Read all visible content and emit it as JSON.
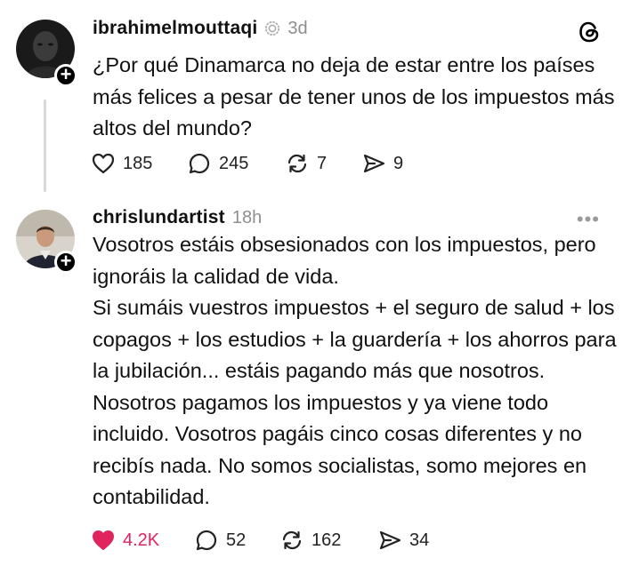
{
  "posts": [
    {
      "username": "ibrahimelmouttaqi",
      "time": "3d",
      "text": "¿Por qué Dinamarca no deja de estar entre los países más felices a pesar de tener unos de los impuestos más altos del mundo?",
      "stats": {
        "likes": "185",
        "replies": "245",
        "reposts": "7",
        "shares": "9"
      }
    },
    {
      "username": "chrislundartist",
      "time": "18h",
      "text": "Vosotros estáis obsesionados con los impuestos, pero ignoráis la calidad de vida.\nSi sumáis vuestros impuestos +  el seguro de salud +  los copagos + los estudios + la guardería + los ahorros para la jubilación... estáis pagando más que nosotros. Nosotros pagamos los impuestos y ya viene todo incluido. Vosotros pagáis cinco cosas diferentes y no recibís nada. No somos socialistas, somo mejores en contabilidad.",
      "stats": {
        "likes": "4.2K",
        "replies": "52",
        "reposts": "162",
        "shares": "34"
      },
      "liked": true
    }
  ],
  "colors": {
    "like_active": "#e0245e",
    "secondary_text": "#8e8e8e",
    "thread_line": "#d9d9d9"
  },
  "icons": [
    "threads-logo-icon",
    "verified-icon",
    "heart-icon",
    "comment-icon",
    "repost-icon",
    "share-icon",
    "more-icon",
    "plus-icon"
  ]
}
